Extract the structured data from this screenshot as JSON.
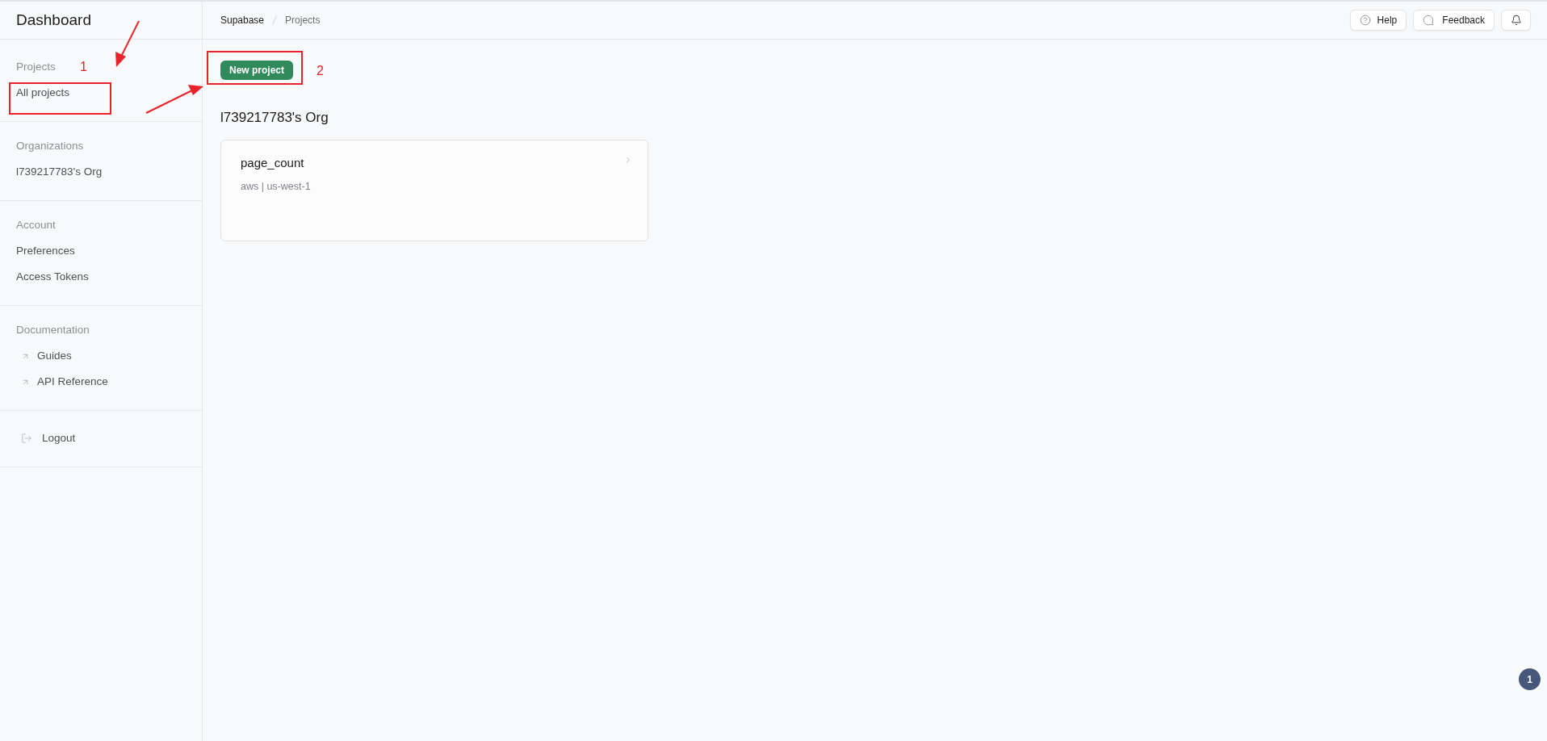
{
  "sidebar": {
    "title": "Dashboard",
    "sections": [
      {
        "heading": "Projects",
        "items": [
          {
            "kind": "link",
            "label": "All projects"
          }
        ]
      },
      {
        "heading": "Organizations",
        "items": [
          {
            "kind": "link",
            "label": "l739217783's Org"
          }
        ]
      },
      {
        "heading": "Account",
        "items": [
          {
            "kind": "link",
            "label": "Preferences"
          },
          {
            "kind": "link",
            "label": "Access Tokens"
          }
        ]
      },
      {
        "heading": "Documentation",
        "items": [
          {
            "kind": "external",
            "label": "Guides"
          },
          {
            "kind": "external",
            "label": "API Reference"
          }
        ]
      },
      {
        "items": [
          {
            "kind": "logout",
            "label": "Logout"
          }
        ]
      }
    ]
  },
  "topbar": {
    "breadcrumb": [
      "Supabase",
      "Projects"
    ],
    "actions": [
      {
        "kind": "help",
        "label": "Help"
      },
      {
        "kind": "feedback",
        "label": "Feedback"
      },
      {
        "kind": "notifications"
      }
    ]
  },
  "main": {
    "new_project_button": "New project",
    "organizations": [
      {
        "name": "l739217783's Org",
        "projects": [
          {
            "name": "page_count",
            "region": "aws | us-west-1"
          }
        ]
      }
    ]
  },
  "floating_badge": "1",
  "annotations": [
    {
      "label": "1"
    },
    {
      "label": "2"
    }
  ]
}
